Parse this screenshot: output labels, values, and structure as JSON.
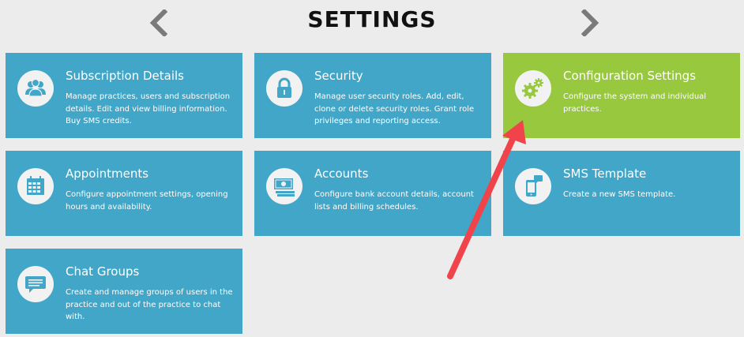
{
  "header": {
    "title": "SETTINGS",
    "prev_icon": "chevron-left-icon",
    "next_icon": "chevron-right-icon"
  },
  "colors": {
    "tile_blue": "#41a6c8",
    "tile_green": "#97c83e",
    "icon_bg": "#f2f2f2",
    "annotation_red": "#f0444a"
  },
  "tiles": [
    {
      "title": "Subscription Details",
      "description": "Manage practices, users and subscription details. Edit and view billing information. Buy SMS credits.",
      "icon": "users-icon",
      "active": false
    },
    {
      "title": "Security",
      "description": "Manage user security roles. Add, edit, clone or delete security roles. Grant role privileges and reporting access.",
      "icon": "lock-icon",
      "active": false
    },
    {
      "title": "Configuration Settings",
      "description": "Configure the system and individual practices.",
      "icon": "gears-icon",
      "active": true
    },
    {
      "title": "Appointments",
      "description": "Configure appointment settings, opening hours and availability.",
      "icon": "calendar-icon",
      "active": false
    },
    {
      "title": "Accounts",
      "description": "Configure bank account details, account lists and billing schedules.",
      "icon": "money-icon",
      "active": false
    },
    {
      "title": "SMS Template",
      "description": "Create a new SMS template.",
      "icon": "mobile-message-icon",
      "active": false
    },
    {
      "title": "Chat Groups",
      "description": "Create and manage groups of users in the practice and out of the practice to chat with.",
      "icon": "chat-icon",
      "active": false
    }
  ],
  "annotation": {
    "type": "arrow",
    "points_to": "Configuration Settings"
  }
}
